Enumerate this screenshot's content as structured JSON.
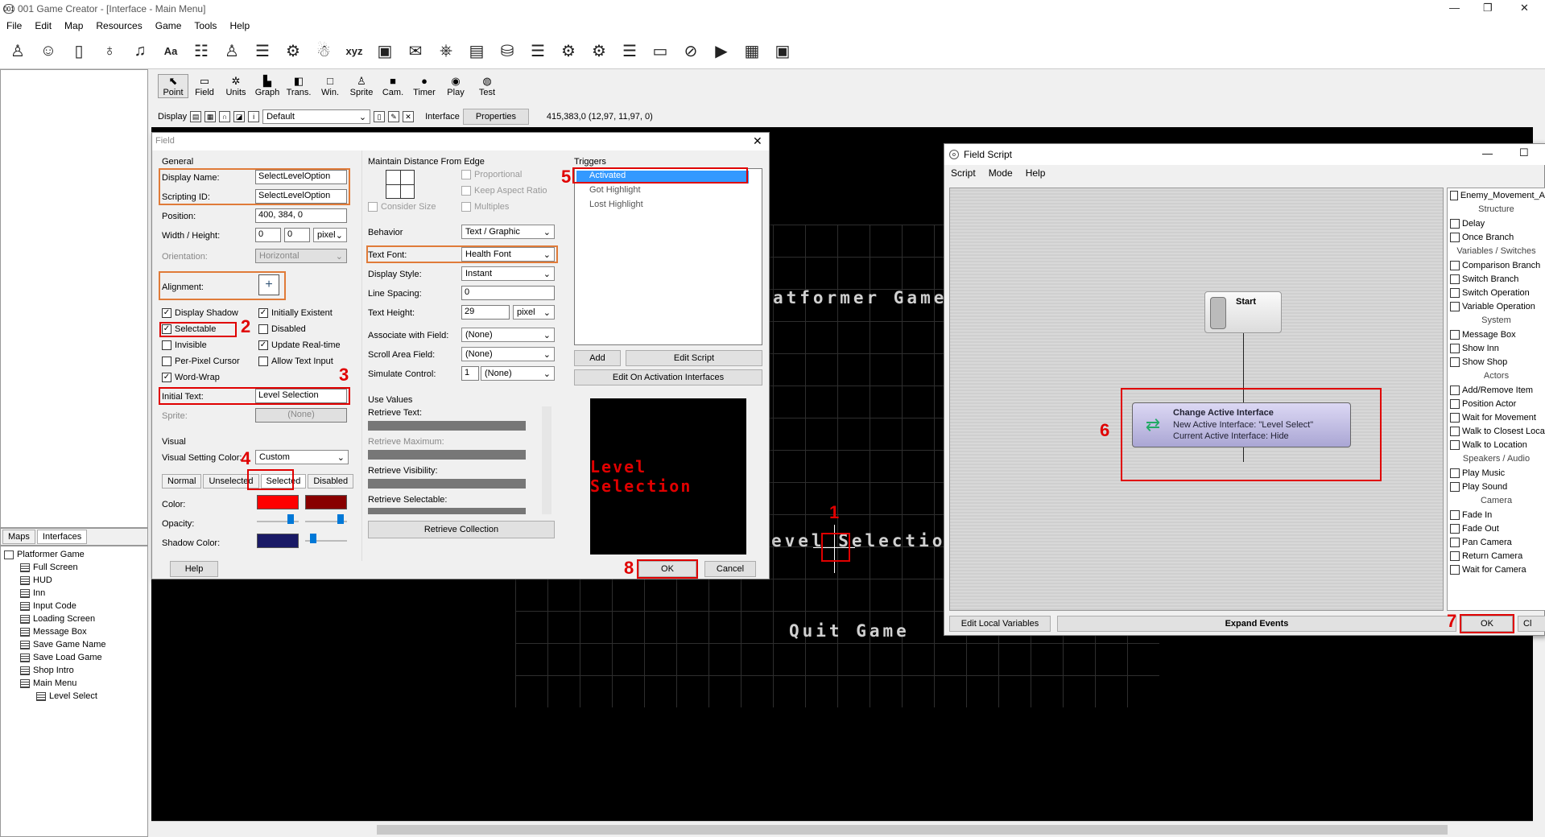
{
  "window": {
    "title": "001 Game Creator - [Interface - Main Menu]",
    "icon": "001"
  },
  "menu": [
    "File",
    "Edit",
    "Map",
    "Resources",
    "Game",
    "Tools",
    "Help"
  ],
  "toolbar1_icons": [
    "actor-icon",
    "player-icon",
    "door-icon",
    "bag-icon",
    "music-icon",
    "font-icon",
    "group-icon",
    "person-icon",
    "list-icon",
    "globe-icon",
    "people-icon",
    "xyz-icon",
    "frame-icon",
    "note-icon",
    "gamepad-icon",
    "device-icon",
    "database-icon",
    "list2-icon",
    "gear-icon",
    "gears-icon",
    "table-icon",
    "label-icon",
    "no-icon",
    "play-icon",
    "film-icon",
    "save-icon"
  ],
  "toolbar2": {
    "items": [
      "Point",
      "Field",
      "Units",
      "Graph",
      "Trans.",
      "Win.",
      "Sprite",
      "Cam.",
      "Timer",
      "Play",
      "Test"
    ],
    "glyphs": [
      "⬉",
      "▭",
      "✲",
      "▙",
      "◧",
      "□",
      "♙",
      "■",
      "●",
      "◉",
      "◍"
    ]
  },
  "toolbar3": {
    "display_label": "Display",
    "layer_value": "Default",
    "interface_label": "Interface",
    "properties_label": "Properties",
    "coords": "415,383,0 (12,97, 11,97, 0)"
  },
  "tabs": {
    "maps": "Maps",
    "interfaces": "Interfaces"
  },
  "tree": {
    "root": "Platformer Game",
    "items": [
      "Full Screen",
      "HUD",
      "Inn",
      "Input Code",
      "Loading Screen",
      "Message Box",
      "Save Game Name",
      "Save Load Game",
      "Shop Intro",
      "Main Menu",
      "Level Select"
    ]
  },
  "game_canvas": {
    "title_text": "atformer Game",
    "level_text": "evel Selection",
    "quit_text": "Quit Game"
  },
  "field_dialog": {
    "title": "Field",
    "general": "General",
    "display_name_label": "Display Name:",
    "display_name": "SelectLevelOption",
    "scripting_id_label": "Scripting ID:",
    "scripting_id": "SelectLevelOption",
    "position_label": "Position:",
    "position": "400, 384, 0",
    "wh_label": "Width / Height:",
    "width": "0",
    "height": "0",
    "wh_unit": "pixel",
    "orientation_label": "Orientation:",
    "orientation": "Horizontal",
    "alignment_label": "Alignment:",
    "checks": {
      "display_shadow": "Display Shadow",
      "initially_existent": "Initially Existent",
      "selectable": "Selectable",
      "disabled": "Disabled",
      "invisible": "Invisible",
      "update_realtime": "Update Real-time",
      "per_pixel": "Per-Pixel Cursor",
      "allow_text": "Allow Text Input",
      "word_wrap": "Word-Wrap"
    },
    "initial_text_label": "Initial Text:",
    "initial_text": "Level Selection",
    "sprite_label": "Sprite:",
    "sprite": "(None)",
    "visual": "Visual",
    "vsc_label": "Visual Setting Color:",
    "vsc": "Custom",
    "vtabs": [
      "Normal",
      "Unselected",
      "Selected",
      "Disabled"
    ],
    "color_label": "Color:",
    "opacity_label": "Opacity:",
    "shadow_label": "Shadow Color:",
    "color1": "#ff0000",
    "color2": "#880000",
    "shadow_color": "#1a1a66",
    "mdfe": "Maintain Distance From Edge",
    "proportional": "Proportional",
    "keep_aspect": "Keep Aspect Ratio",
    "consider_size": "Consider Size",
    "multiples": "Multiples",
    "behavior_label": "Behavior",
    "behavior": "Text / Graphic",
    "text_font_label": "Text Font:",
    "text_font": "Health Font",
    "display_style_label": "Display Style:",
    "display_style": "Instant",
    "line_spacing_label": "Line Spacing:",
    "line_spacing": "0",
    "text_height_label": "Text Height:",
    "text_height": "29",
    "text_height_unit": "pixel",
    "assoc_label": "Associate with Field:",
    "assoc": "(None)",
    "scroll_label": "Scroll Area Field:",
    "scroll": "(None)",
    "sim_label": "Simulate Control:",
    "sim_num": "1",
    "sim": "(None)",
    "use_values": "Use Values",
    "uv": [
      "Retrieve Text:",
      "Retrieve Maximum:",
      "Retrieve Visibility:",
      "Retrieve Selectable:"
    ],
    "retrieve_collection": "Retrieve Collection",
    "triggers": "Triggers",
    "trigger_items": [
      "Activated",
      "Got Highlight",
      "Lost Highlight"
    ],
    "add": "Add",
    "edit_script": "Edit Script",
    "edit_on_activation": "Edit On Activation Interfaces",
    "preview_text": "Level Selection",
    "help": "Help",
    "ok": "OK",
    "cancel": "Cancel"
  },
  "script_window": {
    "title": "Field Script",
    "menu": [
      "Script",
      "Mode",
      "Help"
    ],
    "start": "Start",
    "node_title": "Change Active Interface",
    "node_line1": "New Active Interface: \"Level Select\"",
    "node_line2": "Current Active Interface: Hide",
    "edit_local": "Edit Local Variables",
    "expand": "Expand Events",
    "ok": "OK",
    "close": "Cl",
    "palette": [
      {
        "t": "i",
        "v": "Enemy_Movement_A"
      },
      {
        "t": "h",
        "v": "Structure"
      },
      {
        "t": "i",
        "v": "Delay"
      },
      {
        "t": "i",
        "v": "Once Branch"
      },
      {
        "t": "h",
        "v": "Variables / Switches"
      },
      {
        "t": "i",
        "v": "Comparison Branch"
      },
      {
        "t": "i",
        "v": "Switch Branch"
      },
      {
        "t": "i",
        "v": "Switch Operation"
      },
      {
        "t": "i",
        "v": "Variable Operation"
      },
      {
        "t": "h",
        "v": "System"
      },
      {
        "t": "i",
        "v": "Message Box"
      },
      {
        "t": "i",
        "v": "Show Inn"
      },
      {
        "t": "i",
        "v": "Show Shop"
      },
      {
        "t": "h",
        "v": "Actors"
      },
      {
        "t": "i",
        "v": "Add/Remove Item"
      },
      {
        "t": "i",
        "v": "Position Actor"
      },
      {
        "t": "i",
        "v": "Wait for Movement"
      },
      {
        "t": "i",
        "v": "Walk to Closest Loca"
      },
      {
        "t": "i",
        "v": "Walk to Location"
      },
      {
        "t": "h",
        "v": "Speakers / Audio"
      },
      {
        "t": "i",
        "v": "Play Music"
      },
      {
        "t": "i",
        "v": "Play Sound"
      },
      {
        "t": "h",
        "v": "Camera"
      },
      {
        "t": "i",
        "v": "Fade In"
      },
      {
        "t": "i",
        "v": "Fade Out"
      },
      {
        "t": "i",
        "v": "Pan Camera"
      },
      {
        "t": "i",
        "v": "Return Camera"
      },
      {
        "t": "i",
        "v": "Wait for Camera"
      }
    ]
  },
  "annotations": [
    "1",
    "2",
    "3",
    "4",
    "5",
    "6",
    "7",
    "8"
  ],
  "colors": {
    "highlight_orange": "#e07b39",
    "highlight_red": "#e00000",
    "selection_blue": "#3399ff"
  }
}
